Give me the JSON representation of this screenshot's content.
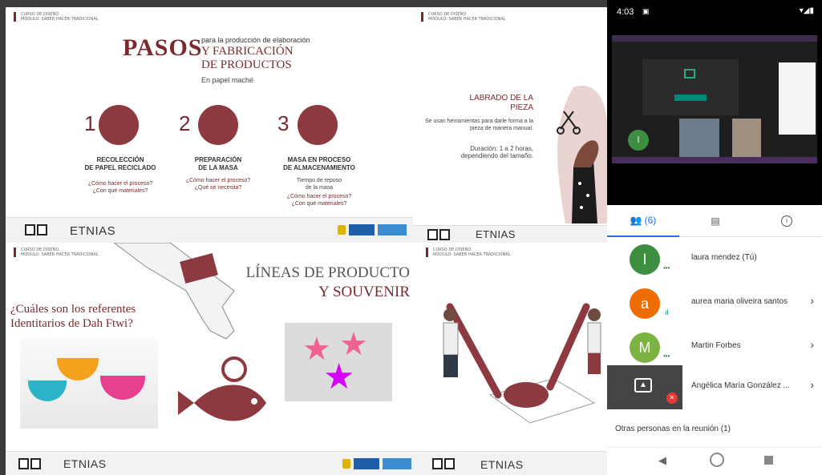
{
  "slides": {
    "course_line1": "CURSO DE DISEÑO",
    "course_line2": "MÓDULO: SABER HACER TRADICIONAL",
    "footer_label": "ETNIAS"
  },
  "slide1": {
    "title_big": "PASOS",
    "title_line1": "para la producción de elaboración",
    "title_line2": "Y FABRICACIÓN",
    "title_line3": "DE PRODUCTOS",
    "subtitle": "En papel maché",
    "steps": [
      {
        "num": "1",
        "title_a": "RECOLECCIÓN",
        "title_b": "DE PAPEL RECICLADO",
        "q1": "¿Cómo hacer el proceso?",
        "q2": "¿Con qué materiales?",
        "q3": "",
        "q4": ""
      },
      {
        "num": "2",
        "title_a": "PREPARACIÓN",
        "title_b": "DE LA MASA",
        "q1": "¿Cómo hacer el proceso?",
        "q2": "¿Qué se necesita?",
        "q3": "",
        "q4": ""
      },
      {
        "num": "3",
        "title_a": "MASA EN PROCESO",
        "title_b": "DE ALMACENAMIENTO",
        "q1": "Tiempo de reposo",
        "q2": "de la masa",
        "q3": "¿Cómo hacer el proceso?",
        "q4": "¿Con qué materiales?"
      }
    ]
  },
  "slide2": {
    "heading1": "LABRADO DE LA",
    "heading2": "PIEZA",
    "body": "Se usan herramientas para darle forma a la pieza de manera manual.",
    "duration": "Duración: 1 a 2 horas,",
    "duration2": "dependiendo del tamaño."
  },
  "slide3": {
    "title1": "LÍNEAS DE PRODUCTO",
    "title2": "Y SOUVENIR",
    "question1": "¿Cuáles son los referentes",
    "question2": "Identitarios de Dah Ftwi?"
  },
  "phone": {
    "time": "4:03",
    "tab_people": "(6)",
    "participants": [
      {
        "initial": "l",
        "name": "laura mendez (Tú)",
        "color": "#3e8e41"
      },
      {
        "initial": "a",
        "name": "aurea maria oliveira santos",
        "color": "#ef6c00"
      },
      {
        "initial": "M",
        "name": "Martin Forbes",
        "color": "#7cb342"
      },
      {
        "initial": "",
        "name": "Angélica María González ...",
        "color": "#444444"
      }
    ],
    "others_label": "Otras personas en la reunión (1)",
    "meet_tile_initial": "l"
  }
}
